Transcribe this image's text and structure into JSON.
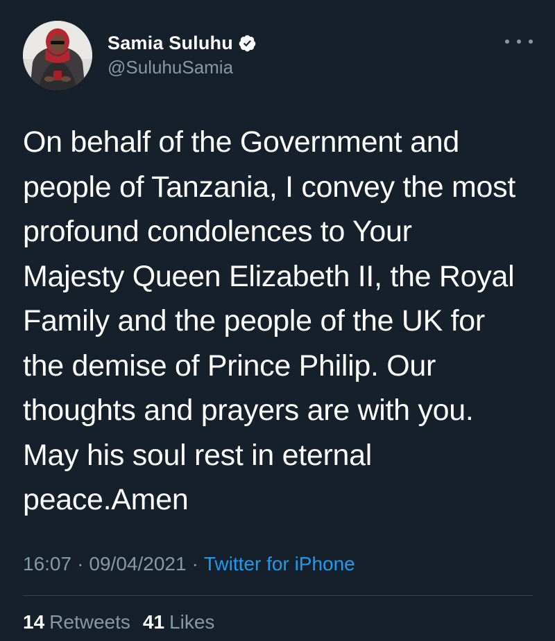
{
  "author": {
    "display_name": "Samia Suluhu",
    "handle": "@SuluhuSamia",
    "verified": true,
    "avatar": "profile-photo"
  },
  "tweet": {
    "text": "On behalf of the Government and\npeople of Tanzania, I convey the most\nprofound condolences to Your\nMajesty Queen Elizabeth II, the Royal\nFamily and the people of the UK for\nthe demise of Prince Philip. Our\nthoughts and prayers are with you.\nMay his soul rest in eternal\npeace.Amen",
    "time": "16:07",
    "date": "09/04/2021",
    "separator": "·",
    "source": "Twitter for iPhone"
  },
  "stats": {
    "retweets_count": "14",
    "retweets_label": "Retweets",
    "likes_count": "41",
    "likes_label": "Likes"
  },
  "icons": {
    "verified": "verified-badge-icon",
    "more": "more-options-icon"
  },
  "colors": {
    "background": "#15202b",
    "primary_text": "#ffffff",
    "secondary_text": "#8899a6",
    "link": "#1d9bf0",
    "divider": "#38444d"
  }
}
